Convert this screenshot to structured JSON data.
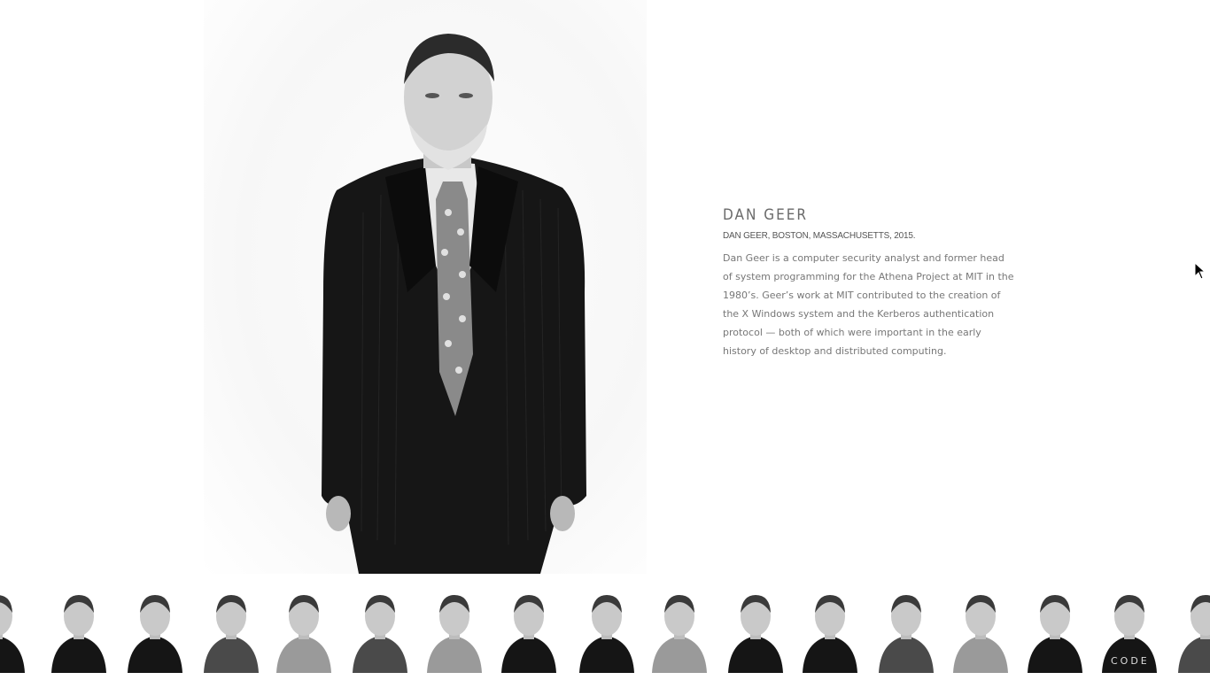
{
  "person": {
    "name": "DAN GEER",
    "caption": "DAN GEER, BOSTON, MASSACHUSETTS, 2015.",
    "bio": "Dan Geer is a computer security analyst and former head of system programming for the Athena Project at MIT in the 1980’s. Geer’s work at MIT contributed to the creation of the X Windows system and the Kerberos authentication protocol — both of which were important in the early history of desktop and distributed computing."
  },
  "thumbnails": [
    {
      "name": "portrait-thumbnail",
      "shirt": "dark"
    },
    {
      "name": "portrait-thumbnail",
      "shirt": "dark"
    },
    {
      "name": "portrait-thumbnail",
      "shirt": "dark"
    },
    {
      "name": "portrait-thumbnail",
      "shirt": "mid"
    },
    {
      "name": "portrait-thumbnail",
      "shirt": "light"
    },
    {
      "name": "portrait-thumbnail",
      "shirt": "mid"
    },
    {
      "name": "portrait-thumbnail",
      "shirt": "light"
    },
    {
      "name": "portrait-thumbnail",
      "shirt": "dark"
    },
    {
      "name": "portrait-thumbnail",
      "shirt": "dark"
    },
    {
      "name": "portrait-thumbnail",
      "shirt": "light"
    },
    {
      "name": "portrait-thumbnail",
      "shirt": "dark"
    },
    {
      "name": "portrait-thumbnail",
      "shirt": "dark"
    },
    {
      "name": "portrait-thumbnail",
      "shirt": "mid"
    },
    {
      "name": "portrait-thumbnail",
      "shirt": "light"
    },
    {
      "name": "portrait-thumbnail",
      "shirt": "dark"
    },
    {
      "name": "portrait-thumbnail",
      "shirt": "dark",
      "shirt_text": "CODE"
    },
    {
      "name": "portrait-thumbnail",
      "shirt": "mid"
    }
  ],
  "colors": {
    "background": "#ffffff",
    "title": "#6a6a6a",
    "caption": "#555555",
    "body": "#777777"
  }
}
